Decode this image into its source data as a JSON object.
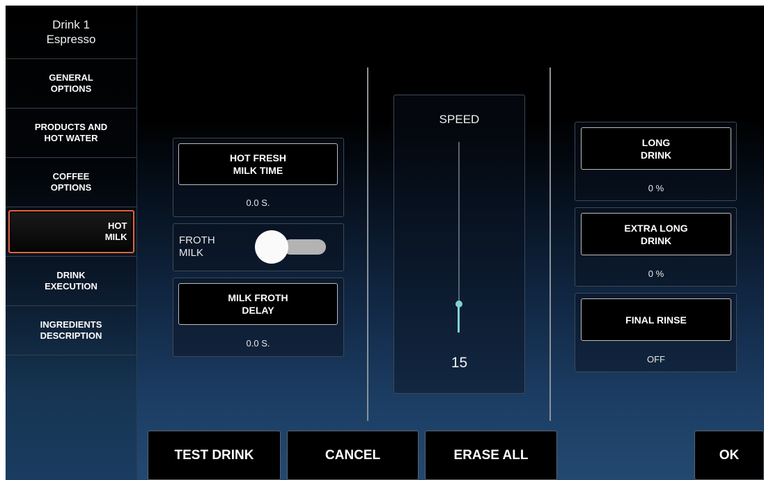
{
  "sidebar": {
    "title_line1": "Drink 1",
    "title_line2": "Espresso",
    "items": [
      {
        "line1": "GENERAL",
        "line2": "OPTIONS"
      },
      {
        "line1": "PRODUCTS AND",
        "line2": "HOT WATER"
      },
      {
        "line1": "COFFEE",
        "line2": "OPTIONS"
      },
      {
        "line1": "HOT",
        "line2": "MILK",
        "active": true
      },
      {
        "line1": "DRINK",
        "line2": "EXECUTION"
      },
      {
        "line1": "INGREDIENTS",
        "line2": "DESCRIPTION"
      }
    ]
  },
  "left_panel": {
    "hot_fresh_milk_time": {
      "line1": "HOT FRESH",
      "line2": "MILK TIME",
      "value": "0.0 S."
    },
    "froth_milk": {
      "line1": "FROTH",
      "line2": "MILK",
      "enabled": false
    },
    "milk_froth_delay": {
      "line1": "MILK FROTH",
      "line2": "DELAY",
      "value": "0.0 S."
    }
  },
  "speed": {
    "label": "SPEED",
    "value": "15",
    "level_fraction": 0.15
  },
  "right_panel": {
    "long_drink": {
      "line1": "LONG",
      "line2": "DRINK",
      "value": "0 %"
    },
    "extra_long_drink": {
      "line1": "EXTRA LONG",
      "line2": "DRINK",
      "value": "0 %"
    },
    "final_rinse": {
      "label": "FINAL RINSE",
      "value": "OFF"
    }
  },
  "bottom": {
    "test_drink": "TEST DRINK",
    "cancel": "CANCEL",
    "erase_all": "ERASE ALL",
    "ok": "OK"
  },
  "colors": {
    "active_border": "#e2643c",
    "slider_accent": "#7fd3cf",
    "toggle_track": "#b3b3b3"
  }
}
